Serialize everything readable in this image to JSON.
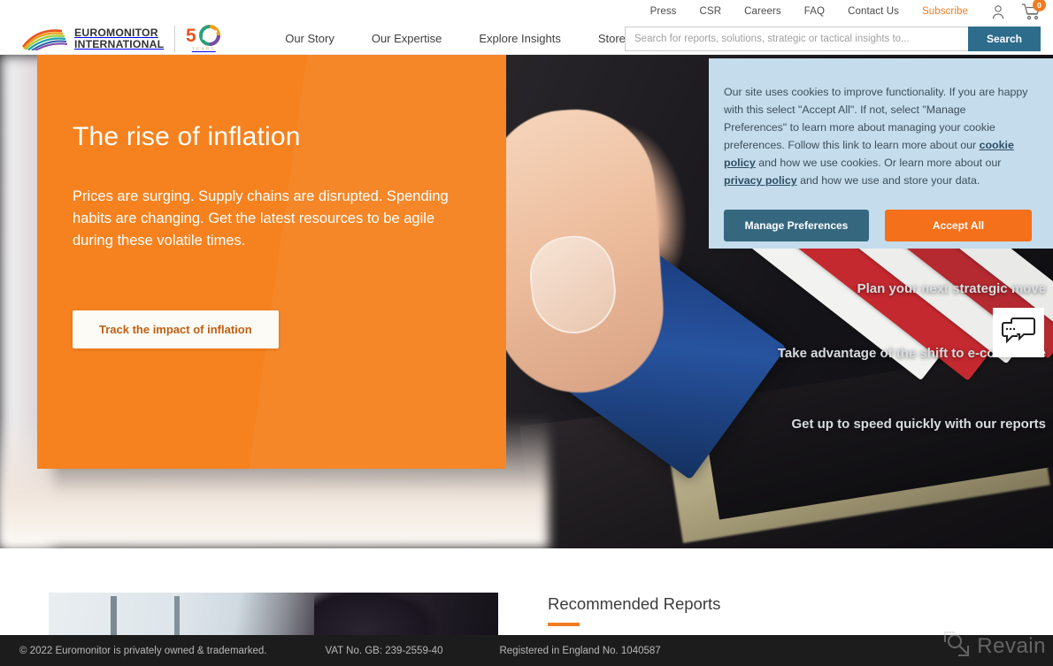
{
  "utility_nav": {
    "links": [
      {
        "label": "Press",
        "accent": false
      },
      {
        "label": "CSR",
        "accent": false
      },
      {
        "label": "Careers",
        "accent": false
      },
      {
        "label": "FAQ",
        "accent": false
      },
      {
        "label": "Contact Us",
        "accent": false
      },
      {
        "label": "Subscribe",
        "accent": true
      }
    ],
    "account_icon": "person-icon",
    "cart_icon": "cart-icon",
    "cart_count": "0"
  },
  "header": {
    "logo": {
      "line1": "EUROMONITOR",
      "line2": "INTERNATIONAL",
      "anniversary": "50",
      "anniversary_sub": "YEARS"
    },
    "nav": [
      {
        "label": "Our Story"
      },
      {
        "label": "Our Expertise"
      },
      {
        "label": "Explore Insights"
      },
      {
        "label": "Store"
      }
    ],
    "search": {
      "placeholder": "Search for reports, solutions, strategic or tactical insights to...",
      "value": "",
      "button_label": "Search"
    }
  },
  "hero": {
    "title": "The rise of inflation",
    "subtitle": "Prices are surging. Supply chains are disrupted. Spending habits are changing. Get the latest resources to be agile during these volatile times.",
    "cta_label": "Track the impact of inflation",
    "side_texts": [
      "Plan your next strategic move",
      "Take advantage of the shift to e-commerce",
      "Get up to speed quickly with our reports"
    ],
    "chat_icon": "chat-bubbles-icon"
  },
  "recommended": {
    "title": "Recommended Reports"
  },
  "cookie_banner": {
    "text_part1": "Our site uses cookies to improve functionality. If you are happy with this select \"Accept All\". If not, select \"Manage Preferences\" to learn more about managing your cookie preferences. Follow this link to learn more about our ",
    "link1": "cookie policy",
    "text_part2": " and how we use cookies. Or learn more about our ",
    "link2": "privacy policy",
    "text_part3": " and how we use and store your data.",
    "manage_label": "Manage Preferences",
    "accept_label": "Accept All"
  },
  "footer": {
    "copyright": "© 2022 Euromonitor is privately owned & trademarked.",
    "vat": "VAT No. GB: 239-2559-40",
    "registration": "Registered in England No. 1040587"
  },
  "watermark": {
    "label": "Revain",
    "icon": "revain-logo-icon"
  },
  "colors": {
    "brand_orange": "#f5821f",
    "accent_orange": "#f07c21",
    "search_blue": "#2e6c8c",
    "cookie_bg": "#c5dcec",
    "manage_btn": "#35687f",
    "footer_bg": "#1c1c1c"
  }
}
